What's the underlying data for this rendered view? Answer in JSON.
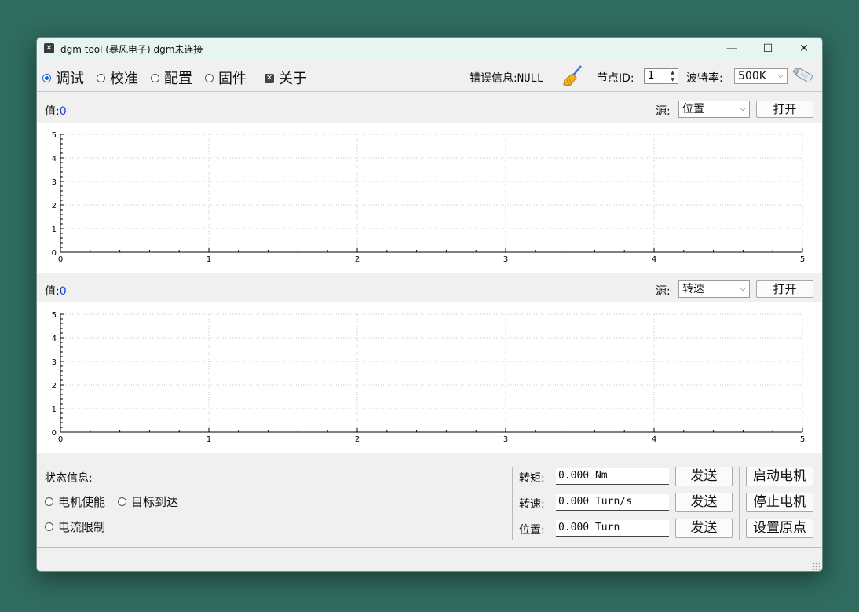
{
  "window": {
    "title": "dgm tool (暴风电子)  dgm未连接",
    "controls": {
      "minimize": "—",
      "maximize": "☐",
      "close": "✕"
    }
  },
  "toolbar": {
    "modes": [
      {
        "label": "调试",
        "selected": true
      },
      {
        "label": "校准",
        "selected": false
      },
      {
        "label": "配置",
        "selected": false
      },
      {
        "label": "固件",
        "selected": false
      }
    ],
    "about_label": "关于",
    "error_label": "错误信息:",
    "error_value": "NULL",
    "node_id_label": "节点ID:",
    "node_id_value": "1",
    "baud_label": "波特率:",
    "baud_value": "500K"
  },
  "panels": [
    {
      "value_label": "值:",
      "value": "0",
      "source_label": "源:",
      "source_value": "位置",
      "open_label": "打开"
    },
    {
      "value_label": "值:",
      "value": "0",
      "source_label": "源:",
      "source_value": "转速",
      "open_label": "打开"
    }
  ],
  "chart_data": [
    {
      "type": "line",
      "x": [],
      "series": [],
      "xlim": [
        0,
        5
      ],
      "ylim": [
        0,
        5
      ],
      "xticks": [
        "0",
        "1",
        "2",
        "3",
        "4",
        "5"
      ],
      "yticks": [
        "0",
        "1",
        "2",
        "3",
        "4",
        "5"
      ],
      "grid": true
    },
    {
      "type": "line",
      "x": [],
      "series": [],
      "xlim": [
        0,
        5
      ],
      "ylim": [
        0,
        5
      ],
      "xticks": [
        "0",
        "1",
        "2",
        "3",
        "4",
        "5"
      ],
      "yticks": [
        "0",
        "1",
        "2",
        "3",
        "4",
        "5"
      ],
      "grid": true
    }
  ],
  "status": {
    "title": "状态信息:",
    "indicators": [
      "电机使能",
      "目标到达",
      "电流限制"
    ]
  },
  "commands": [
    {
      "label": "转矩:",
      "value": "0.000 Nm",
      "send": "发送",
      "action": "启动电机"
    },
    {
      "label": "转速:",
      "value": "0.000 Turn/s",
      "send": "发送",
      "action": "停止电机"
    },
    {
      "label": "位置:",
      "value": "0.000 Turn",
      "send": "发送",
      "action": "设置原点"
    }
  ],
  "colors": {
    "value": "#1a3fd6",
    "accent": "#1b62c8",
    "background": "#2f6b5f"
  }
}
